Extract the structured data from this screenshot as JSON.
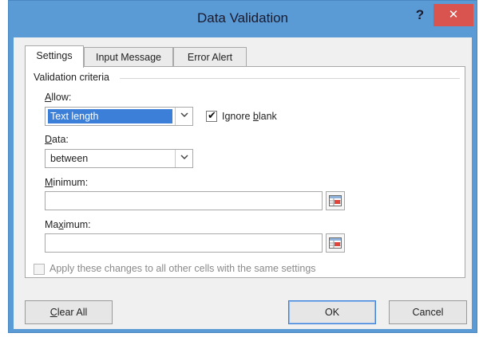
{
  "window": {
    "title": "Data Validation",
    "help_label": "?",
    "close_label": "✕"
  },
  "tabs": [
    {
      "label": "Settings",
      "active": true
    },
    {
      "label": "Input Message",
      "active": false
    },
    {
      "label": "Error Alert",
      "active": false
    }
  ],
  "settings": {
    "group_title": "Validation criteria",
    "allow": {
      "label_pre": "",
      "label_key": "A",
      "label_post": "llow:",
      "value": "Text length"
    },
    "ignore_blank": {
      "label_pre": "Ignore ",
      "label_key": "b",
      "label_post": "lank",
      "checked": true
    },
    "data": {
      "label_pre": "",
      "label_key": "D",
      "label_post": "ata:",
      "value": "between"
    },
    "minimum": {
      "label_pre": "",
      "label_key": "M",
      "label_post": "inimum:",
      "value": ""
    },
    "maximum": {
      "label_pre": "Ma",
      "label_key": "x",
      "label_post": "imum:",
      "value": ""
    },
    "apply_all": {
      "label": "Apply these changes to all other cells with the same settings",
      "checked": false,
      "disabled": true
    }
  },
  "buttons": {
    "clear_all_key": "C",
    "clear_all_rest": "lear All",
    "ok": "OK",
    "cancel": "Cancel"
  },
  "colors": {
    "titlebar": "#5b9bd5",
    "close": "#d9534f",
    "selection": "#3c7fd9"
  },
  "icons": {
    "dropdown": "chevron-down-icon",
    "ref": "range-selector-icon",
    "check": "checkmark-icon"
  }
}
